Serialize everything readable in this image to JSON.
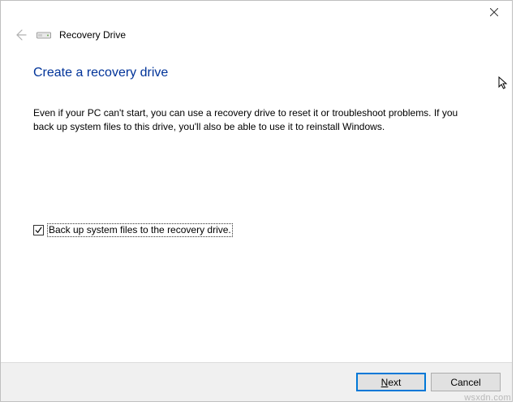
{
  "header": {
    "title": "Recovery Drive"
  },
  "page": {
    "heading": "Create a recovery drive",
    "body": "Even if your PC can't start, you can use a recovery drive to reset it or troubleshoot problems. If you back up system files to this drive, you'll also be able to use it to reinstall Windows."
  },
  "checkbox": {
    "checked": true,
    "label": "Back up system files to the recovery drive."
  },
  "footer": {
    "next_prefix": "N",
    "next_rest": "ext",
    "cancel": "Cancel"
  },
  "watermark": "wsxdn.com"
}
